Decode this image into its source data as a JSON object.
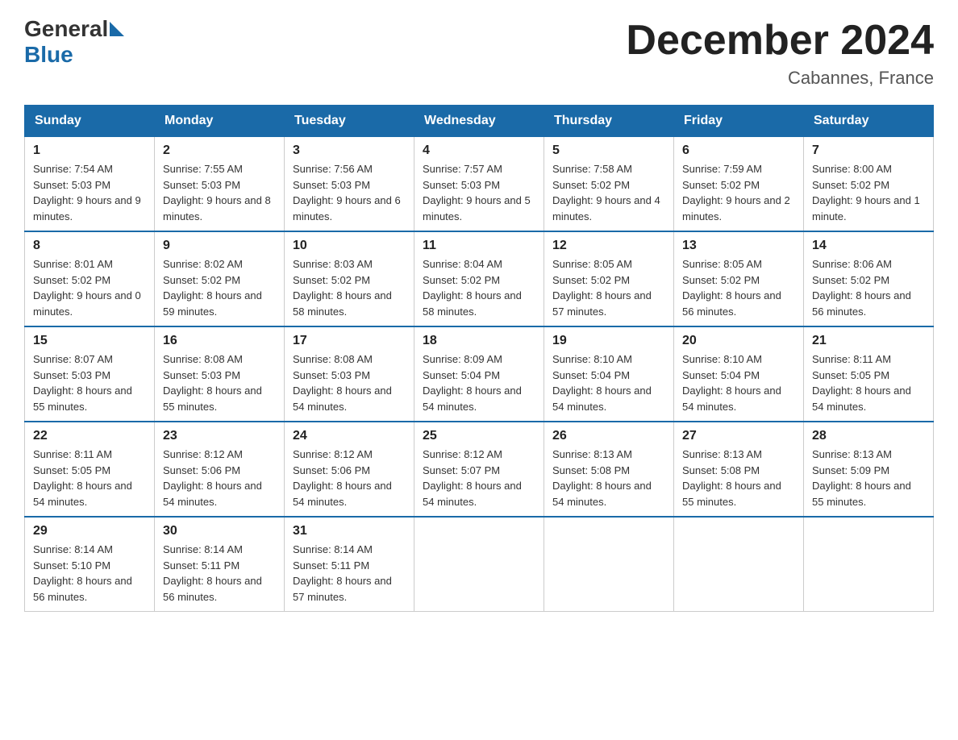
{
  "header": {
    "logo_general": "General",
    "logo_blue": "Blue",
    "month_title": "December 2024",
    "location": "Cabannes, France"
  },
  "days_of_week": [
    "Sunday",
    "Monday",
    "Tuesday",
    "Wednesday",
    "Thursday",
    "Friday",
    "Saturday"
  ],
  "weeks": [
    [
      {
        "day": "1",
        "sunrise": "7:54 AM",
        "sunset": "5:03 PM",
        "daylight": "9 hours and 9 minutes."
      },
      {
        "day": "2",
        "sunrise": "7:55 AM",
        "sunset": "5:03 PM",
        "daylight": "9 hours and 8 minutes."
      },
      {
        "day": "3",
        "sunrise": "7:56 AM",
        "sunset": "5:03 PM",
        "daylight": "9 hours and 6 minutes."
      },
      {
        "day": "4",
        "sunrise": "7:57 AM",
        "sunset": "5:03 PM",
        "daylight": "9 hours and 5 minutes."
      },
      {
        "day": "5",
        "sunrise": "7:58 AM",
        "sunset": "5:02 PM",
        "daylight": "9 hours and 4 minutes."
      },
      {
        "day": "6",
        "sunrise": "7:59 AM",
        "sunset": "5:02 PM",
        "daylight": "9 hours and 2 minutes."
      },
      {
        "day": "7",
        "sunrise": "8:00 AM",
        "sunset": "5:02 PM",
        "daylight": "9 hours and 1 minute."
      }
    ],
    [
      {
        "day": "8",
        "sunrise": "8:01 AM",
        "sunset": "5:02 PM",
        "daylight": "9 hours and 0 minutes."
      },
      {
        "day": "9",
        "sunrise": "8:02 AM",
        "sunset": "5:02 PM",
        "daylight": "8 hours and 59 minutes."
      },
      {
        "day": "10",
        "sunrise": "8:03 AM",
        "sunset": "5:02 PM",
        "daylight": "8 hours and 58 minutes."
      },
      {
        "day": "11",
        "sunrise": "8:04 AM",
        "sunset": "5:02 PM",
        "daylight": "8 hours and 58 minutes."
      },
      {
        "day": "12",
        "sunrise": "8:05 AM",
        "sunset": "5:02 PM",
        "daylight": "8 hours and 57 minutes."
      },
      {
        "day": "13",
        "sunrise": "8:05 AM",
        "sunset": "5:02 PM",
        "daylight": "8 hours and 56 minutes."
      },
      {
        "day": "14",
        "sunrise": "8:06 AM",
        "sunset": "5:02 PM",
        "daylight": "8 hours and 56 minutes."
      }
    ],
    [
      {
        "day": "15",
        "sunrise": "8:07 AM",
        "sunset": "5:03 PM",
        "daylight": "8 hours and 55 minutes."
      },
      {
        "day": "16",
        "sunrise": "8:08 AM",
        "sunset": "5:03 PM",
        "daylight": "8 hours and 55 minutes."
      },
      {
        "day": "17",
        "sunrise": "8:08 AM",
        "sunset": "5:03 PM",
        "daylight": "8 hours and 54 minutes."
      },
      {
        "day": "18",
        "sunrise": "8:09 AM",
        "sunset": "5:04 PM",
        "daylight": "8 hours and 54 minutes."
      },
      {
        "day": "19",
        "sunrise": "8:10 AM",
        "sunset": "5:04 PM",
        "daylight": "8 hours and 54 minutes."
      },
      {
        "day": "20",
        "sunrise": "8:10 AM",
        "sunset": "5:04 PM",
        "daylight": "8 hours and 54 minutes."
      },
      {
        "day": "21",
        "sunrise": "8:11 AM",
        "sunset": "5:05 PM",
        "daylight": "8 hours and 54 minutes."
      }
    ],
    [
      {
        "day": "22",
        "sunrise": "8:11 AM",
        "sunset": "5:05 PM",
        "daylight": "8 hours and 54 minutes."
      },
      {
        "day": "23",
        "sunrise": "8:12 AM",
        "sunset": "5:06 PM",
        "daylight": "8 hours and 54 minutes."
      },
      {
        "day": "24",
        "sunrise": "8:12 AM",
        "sunset": "5:06 PM",
        "daylight": "8 hours and 54 minutes."
      },
      {
        "day": "25",
        "sunrise": "8:12 AM",
        "sunset": "5:07 PM",
        "daylight": "8 hours and 54 minutes."
      },
      {
        "day": "26",
        "sunrise": "8:13 AM",
        "sunset": "5:08 PM",
        "daylight": "8 hours and 54 minutes."
      },
      {
        "day": "27",
        "sunrise": "8:13 AM",
        "sunset": "5:08 PM",
        "daylight": "8 hours and 55 minutes."
      },
      {
        "day": "28",
        "sunrise": "8:13 AM",
        "sunset": "5:09 PM",
        "daylight": "8 hours and 55 minutes."
      }
    ],
    [
      {
        "day": "29",
        "sunrise": "8:14 AM",
        "sunset": "5:10 PM",
        "daylight": "8 hours and 56 minutes."
      },
      {
        "day": "30",
        "sunrise": "8:14 AM",
        "sunset": "5:11 PM",
        "daylight": "8 hours and 56 minutes."
      },
      {
        "day": "31",
        "sunrise": "8:14 AM",
        "sunset": "5:11 PM",
        "daylight": "8 hours and 57 minutes."
      },
      null,
      null,
      null,
      null
    ]
  ]
}
